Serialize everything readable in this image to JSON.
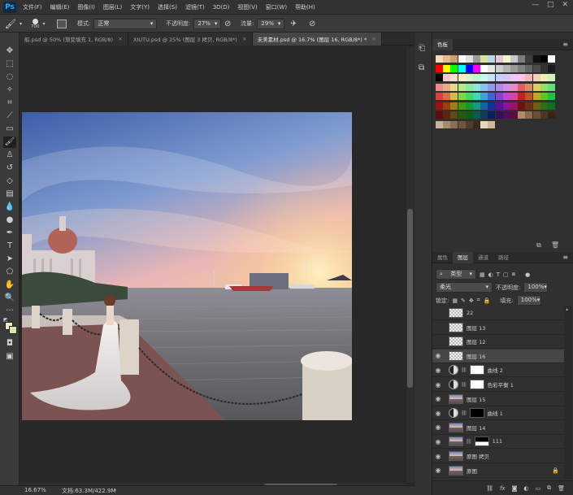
{
  "app": {
    "logo": "Ps"
  },
  "menu": [
    "文件(F)",
    "编辑(E)",
    "图像(I)",
    "图层(L)",
    "文字(Y)",
    "选择(S)",
    "滤镜(T)",
    "3D(D)",
    "视图(V)",
    "窗口(W)",
    "帮助(H)"
  ],
  "options": {
    "brush_size": "700",
    "mode_label": "模式:",
    "mode_value": "正常",
    "opacity_label": "不透明度:",
    "opacity_value": "27%",
    "flow_label": "流量:",
    "flow_value": "29%"
  },
  "tabs": [
    {
      "label": "船.psd @ 50% (渐变填充 1, RGB/8)",
      "close": "×"
    },
    {
      "label": "XIUTU.psd @ 25% (图层 3 拷贝, RGB/8*)",
      "close": "×"
    },
    {
      "label": "未美素材.psd @ 16.7% (图层 16, RGB/8*) *",
      "close": "×"
    }
  ],
  "status": {
    "zoom": "16.67%",
    "doc": "文档:63.3M/422.9M"
  },
  "swatch_panel": {
    "title": "色板"
  },
  "colors": {
    "foreground": "#f3e7c4",
    "background": "#d7e6a6"
  },
  "layers_panel": {
    "tabs": [
      "属性",
      "图层",
      "通道",
      "路径"
    ],
    "filter_label": "类型",
    "blend_mode": "柔光",
    "opacity_label": "不透明度:",
    "opacity_value": "100%",
    "lock_label": "锁定:",
    "fill_label": "填充:",
    "fill_value": "100%",
    "layers": [
      {
        "name": "22",
        "type": "pixel",
        "visible": false
      },
      {
        "name": "图层 13",
        "type": "pixel",
        "visible": false
      },
      {
        "name": "图层 12",
        "type": "pixel",
        "visible": false
      },
      {
        "name": "图层 16",
        "type": "pixel",
        "visible": true,
        "selected": true
      },
      {
        "name": "曲线 2",
        "type": "adjust",
        "visible": true
      },
      {
        "name": "色彩平衡 1",
        "type": "adjust",
        "visible": true
      },
      {
        "name": "图层 15",
        "type": "photo",
        "visible": true
      },
      {
        "name": "曲线 1",
        "type": "adjust-dark",
        "visible": true
      },
      {
        "name": "图层 14",
        "type": "photo",
        "visible": true
      },
      {
        "name": "111",
        "type": "photo-mask",
        "visible": true
      },
      {
        "name": "原图 拷贝",
        "type": "photo",
        "visible": true
      },
      {
        "name": "原图",
        "type": "photo",
        "visible": true,
        "locked": true
      }
    ],
    "footer_fx": "fx"
  }
}
